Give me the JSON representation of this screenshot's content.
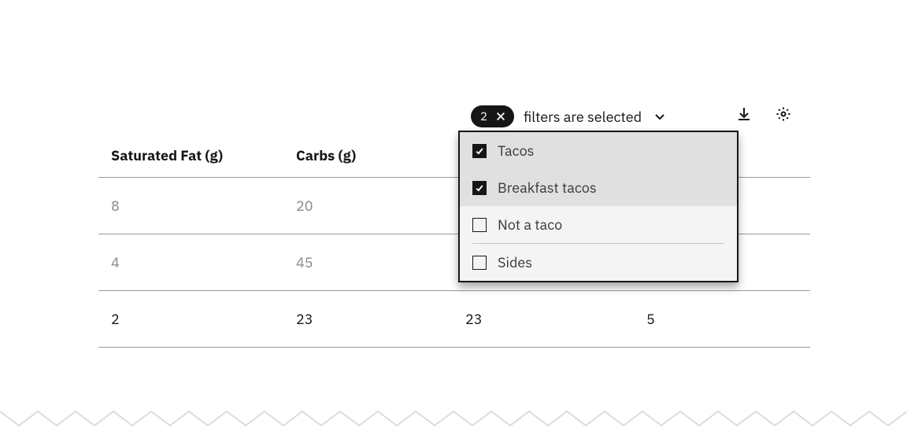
{
  "filter": {
    "count": "2",
    "label": "filters are selected"
  },
  "dropdown": {
    "options": [
      {
        "label": "Tacos",
        "checked": true
      },
      {
        "label": "Breakfast tacos",
        "checked": true
      },
      {
        "label": "Not a taco",
        "checked": false
      },
      {
        "label": "Sides",
        "checked": false
      }
    ]
  },
  "table": {
    "headers": [
      "Saturated Fat (g)",
      "Carbs (g)",
      "",
      ""
    ],
    "rows": [
      [
        "8",
        "20",
        "",
        ""
      ],
      [
        "4",
        "45",
        "",
        ""
      ],
      [
        "2",
        "23",
        "23",
        "5"
      ]
    ]
  }
}
